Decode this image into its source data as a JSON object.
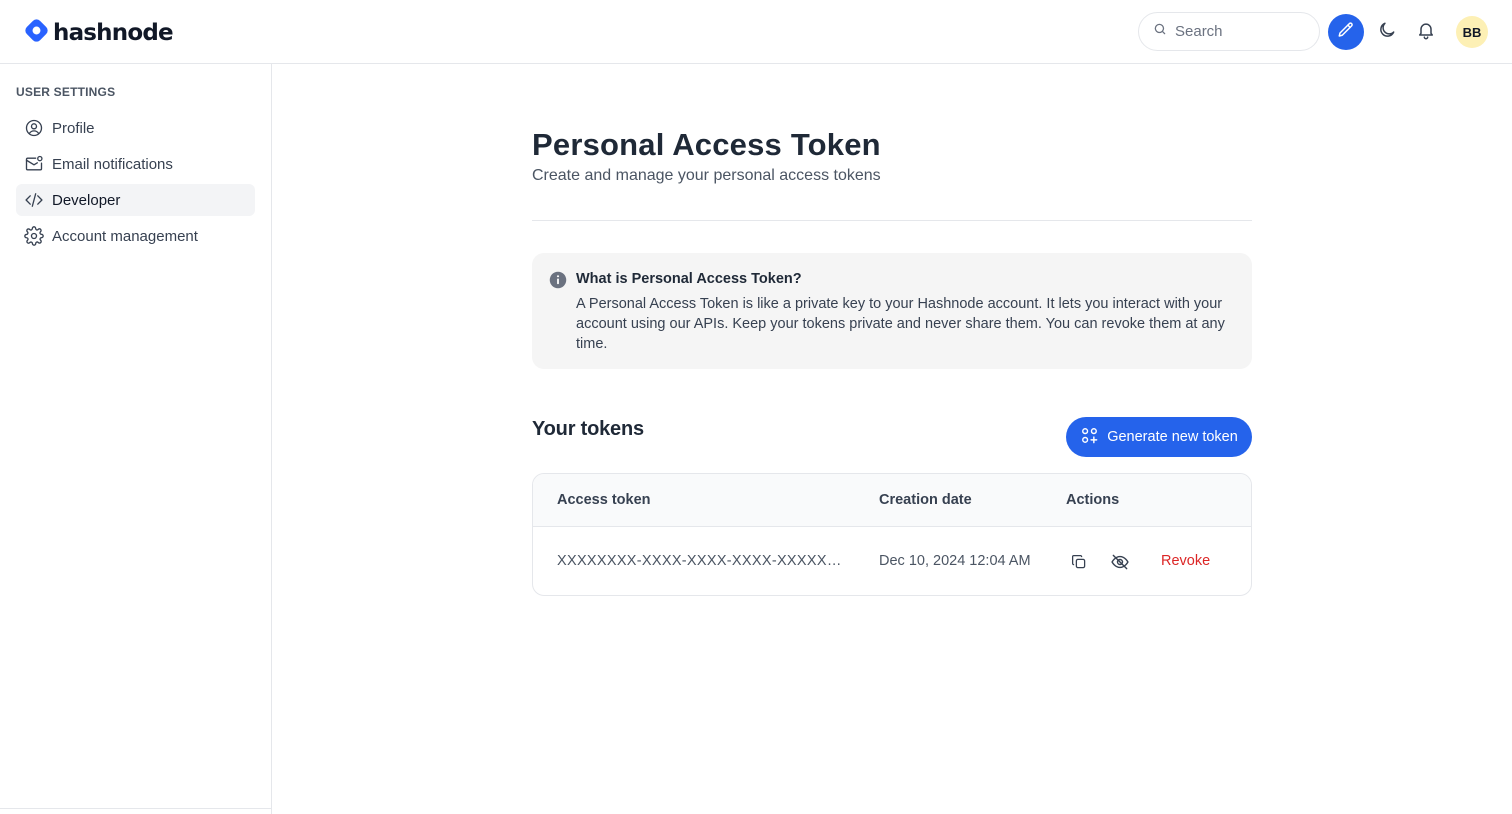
{
  "header": {
    "logo_text": "hashnode",
    "search": {
      "placeholder": "Search"
    },
    "avatar_initials": "BB",
    "icons": [
      "search-icon",
      "pencil-icon",
      "moon-icon",
      "bell-icon"
    ]
  },
  "sidebar": {
    "heading": "USER SETTINGS",
    "items": [
      {
        "label": "Profile",
        "icon": "user-circle-icon",
        "active": false
      },
      {
        "label": "Email notifications",
        "icon": "mail-notification-icon",
        "active": false
      },
      {
        "label": "Developer",
        "icon": "code-icon",
        "active": true
      },
      {
        "label": "Account management",
        "icon": "gear-icon",
        "active": false
      }
    ]
  },
  "main": {
    "title": "Personal Access Token",
    "subtitle": "Create and manage your personal access tokens",
    "info": {
      "icon": "info-icon",
      "title": "What is Personal Access Token?",
      "text": "A Personal Access Token is like a private key to your Hashnode account. It lets you interact with your account using our APIs. Keep your tokens private and never share them. You can revoke them at any time."
    },
    "tokens_heading": "Your tokens",
    "generate_button": "Generate new token",
    "table": {
      "columns": [
        "Access token",
        "Creation date",
        "Actions"
      ],
      "rows": [
        {
          "token": "XXXXXXXX-XXXX-XXXX-XXXX-XXXXXXXXXXXX",
          "created": "Dec 10, 2024 12:04 AM",
          "revoke_label": "Revoke"
        }
      ]
    }
  },
  "colors": {
    "accent": "#2563eb",
    "danger": "#dc2626",
    "avatar_bg": "#fdf0b5"
  }
}
